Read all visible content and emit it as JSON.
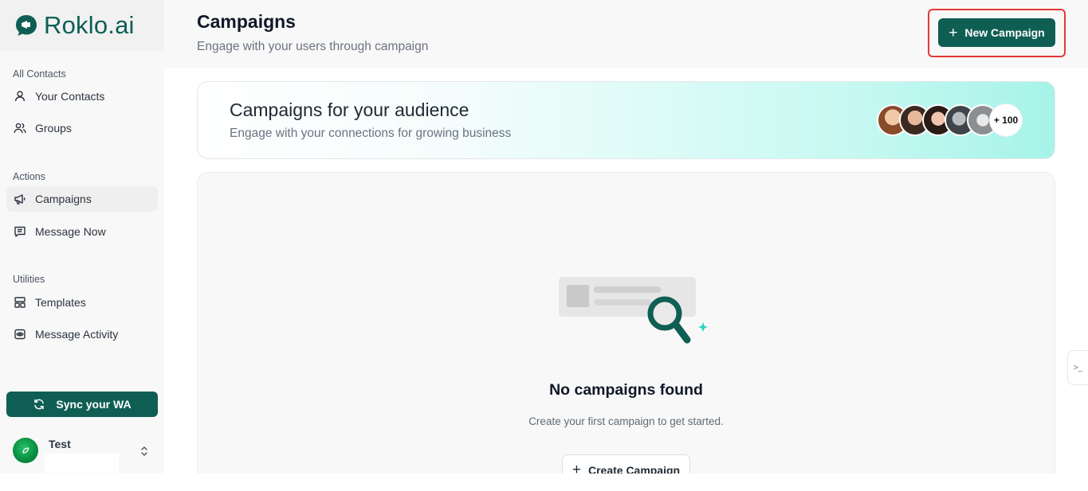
{
  "brand": {
    "name": "Roklo.ai",
    "color": "#0f5e54"
  },
  "sidebar": {
    "sections": [
      {
        "title": "All Contacts",
        "items": [
          {
            "label": "Your Contacts",
            "icon": "user-icon"
          },
          {
            "label": "Groups",
            "icon": "users-icon"
          }
        ]
      },
      {
        "title": "Actions",
        "items": [
          {
            "label": "Campaigns",
            "icon": "megaphone-icon",
            "active": true
          },
          {
            "label": "Message Now",
            "icon": "message-square-icon"
          }
        ]
      },
      {
        "title": "Utilities",
        "items": [
          {
            "label": "Templates",
            "icon": "layout-template-icon"
          },
          {
            "label": "Message Activity",
            "icon": "eye-activity-icon"
          }
        ]
      }
    ],
    "sync_label": "Sync your WA",
    "user": {
      "name": "Test"
    }
  },
  "header": {
    "title": "Campaigns",
    "subtitle": "Engage with your users through campaign",
    "new_button_label": "New Campaign"
  },
  "banner": {
    "title": "Campaigns for your audience",
    "subtitle": "Engage with your connections for growing business",
    "more_count": "+ 100"
  },
  "empty_state": {
    "title": "No campaigns found",
    "subtitle": "Create your first campaign to get started.",
    "button_label": "Create Campaign"
  },
  "colors": {
    "primary": "#0f5e54",
    "highlight_border": "#e53935",
    "accent": "#2dd4bf"
  }
}
